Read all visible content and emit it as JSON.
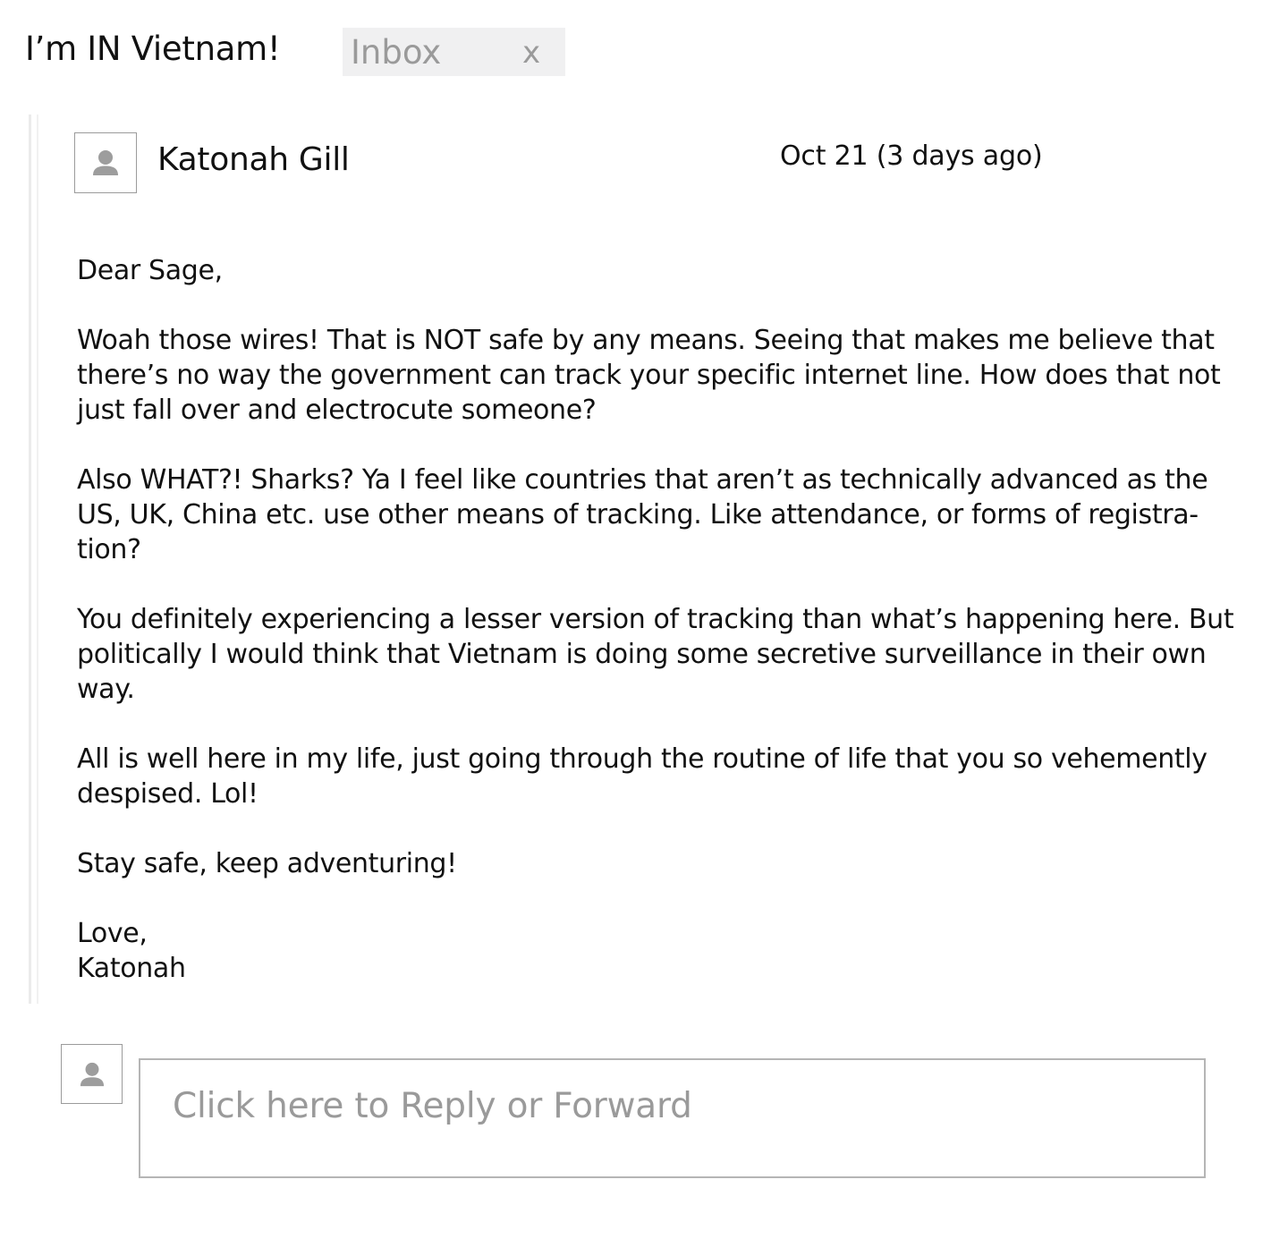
{
  "thread": {
    "subject": "I’m IN Vietnam!",
    "label": {
      "name": "Inbox",
      "remove_glyph": "x"
    }
  },
  "message": {
    "sender": "Katonah Gill",
    "avatar_icon": "person-icon",
    "date": "Oct 21 (3 days ago)",
    "body": [
      "Dear Sage,",
      "Woah those wires! That is NOT safe by any means. Seeing that makes me believe that\nthere’s no way the government can track your specific internet line. How does that not\njust fall over and electrocute someone?",
      "Also WHAT?! Sharks? Ya I feel like countries that aren’t as technically advanced as the\nUS, UK, China etc. use other means of tracking. Like attendance, or forms of registra-\ntion?",
      "You definitely experiencing a lesser version of tracking than what’s happening here. But\npolitically I would think that Vietnam is doing some secretive surveillance in their own\nway.",
      "All is well here in my life, just going through the routine of life that you so vehemently\ndespised. Lol!",
      "Stay safe, keep adventuring!",
      "Love,\nKatonah"
    ]
  },
  "reply": {
    "avatar_icon": "person-icon",
    "placeholder": "Click here to Reply or Forward"
  },
  "colors": {
    "text": "#111111",
    "muted": "#9a9a9a",
    "chip_background": "#f0f0f1",
    "border": "#b5b5b5"
  }
}
